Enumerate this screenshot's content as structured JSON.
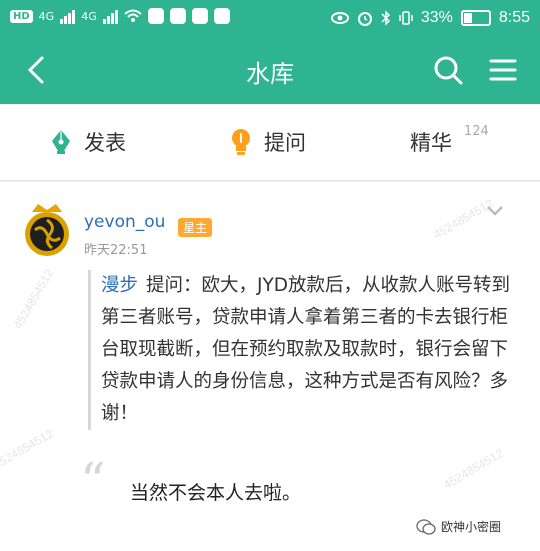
{
  "status_bar": {
    "hd_label": "HD",
    "network_1": "4G",
    "network_2": "4G",
    "battery": "33%",
    "time": "8:55"
  },
  "nav": {
    "title": "水库"
  },
  "tabs": [
    {
      "label": "发表"
    },
    {
      "label": "提问"
    },
    {
      "label": "精华",
      "count": "124"
    }
  ],
  "post": {
    "username": "yevon_ou",
    "badge": "星主",
    "time": "昨天22:51",
    "question_author": "漫步",
    "question_text": "提问：欧大，JYD放款后，从收款人账号转到第三者账号，贷款申请人拿着第三者的卡去银行柜台取现截断，但在预约取款及取款时，银行会留下贷款申请人的身份信息，这种方式是否有风险？多谢！",
    "answer": "当然不会本人去啦。"
  },
  "watermark": {
    "number": "4524854512",
    "label": "欧神小密圈"
  },
  "colors": {
    "primary": "#2eb490",
    "link": "#2c6fb6",
    "badge": "#ffa931"
  },
  "icons": [
    "back-arrow-icon",
    "search-icon",
    "menu-icon",
    "pen-icon",
    "lightbulb-icon",
    "chevron-down-icon",
    "wechat-icon"
  ]
}
